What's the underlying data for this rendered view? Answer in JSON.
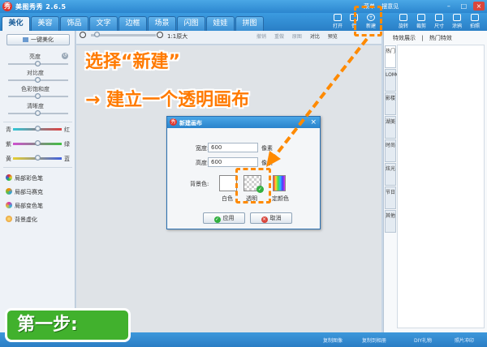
{
  "app": {
    "title": "美图秀秀 2.6.5",
    "logo_glyph": "秀",
    "title_links": [
      "菜单",
      "摆意见"
    ],
    "window_buttons": [
      "–",
      "□",
      "×"
    ]
  },
  "tabs": [
    "美化",
    "美容",
    "饰品",
    "文字",
    "边框",
    "场景",
    "闪图",
    "娃娃",
    "拼图"
  ],
  "active_tab": "美化",
  "toolbar_tools": [
    {
      "label": "打开",
      "icon": "open-icon"
    },
    {
      "label": "保",
      "icon": "save-icon"
    },
    {
      "label": "新建",
      "icon": "new-icon"
    },
    {
      "label": "旋转",
      "icon": "rotate-icon"
    },
    {
      "label": "裁剪",
      "icon": "crop-icon"
    },
    {
      "label": "尺寸",
      "icon": "resize-icon"
    },
    {
      "label": "涂鸦",
      "icon": "doodle-icon"
    },
    {
      "label": "拍照",
      "icon": "camera-icon"
    }
  ],
  "left_panel": {
    "one_key": "一键美化",
    "adjustments": [
      "亮度",
      "对比度",
      "色彩饱和度",
      "清晰度"
    ],
    "channels": [
      {
        "left": "青",
        "right": "红"
      },
      {
        "left": "紫",
        "right": "绿"
      },
      {
        "left": "黄",
        "right": "蓝"
      }
    ],
    "tools": [
      "局部彩色笔",
      "局部马赛克",
      "局部变色笔",
      "背景虚化"
    ]
  },
  "canvas_bar": {
    "zoom_text": "1:1原大",
    "tools": [
      "撤销",
      "重做",
      "原图",
      "对比",
      "预览"
    ]
  },
  "right_panel": {
    "header": [
      "特效展示",
      "|",
      "热门特效"
    ],
    "vertical_tabs": [
      "热门",
      "LOMO",
      "影楼",
      "湖美",
      "时尚",
      "炫光",
      "节日",
      "其他"
    ]
  },
  "status_bar": [
    "复制图像",
    "复制到相册",
    "DIY礼物",
    "照片冲印"
  ],
  "dialog": {
    "title": "新建画布",
    "width_label": "宽度:",
    "width_value": "600",
    "height_label": "高度:",
    "height_value": "600",
    "unit": "像素",
    "bg_label": "背景色:",
    "options": [
      "白色",
      "透明",
      "定颜色"
    ],
    "selected_option": "透明",
    "apply": "应用",
    "cancel": "取消"
  },
  "tutorial": {
    "callout_1": "选择“新建”",
    "callout_2": "→ 建立一个透明画布",
    "step": "第一步:",
    "accent_color": "#ff8a00",
    "step_color": "#41b12d"
  }
}
